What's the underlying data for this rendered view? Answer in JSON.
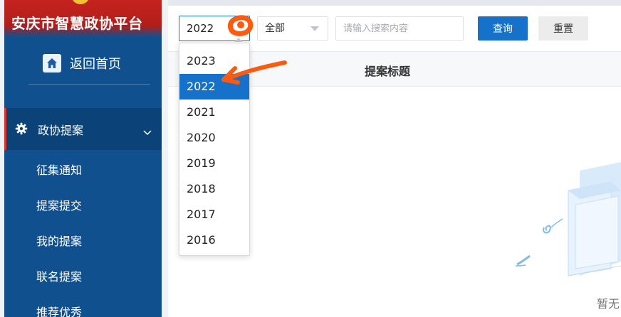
{
  "sidebar": {
    "app_title": "安庆市智慧政协平台",
    "home_label": "返回首页",
    "menu_group": {
      "label": "政协提案",
      "icon": "gear-icon",
      "expanded": true
    },
    "items": [
      {
        "label": "征集通知"
      },
      {
        "label": "提案提交"
      },
      {
        "label": "我的提案"
      },
      {
        "label": "联名提案"
      },
      {
        "label": "推荐优秀"
      }
    ]
  },
  "filters": {
    "year_value": "2022",
    "scope_value": "全部",
    "search_placeholder": "请输入搜索内容",
    "query_label": "查询",
    "reset_label": "重置"
  },
  "table": {
    "columns": [
      "提案标题"
    ]
  },
  "year_dropdown": {
    "options": [
      "2023",
      "2022",
      "2021",
      "2020",
      "2019",
      "2018",
      "2017",
      "2016"
    ],
    "selected": "2022"
  },
  "empty_state": {
    "text": "暂无"
  },
  "colors": {
    "sidebar_bg": "#10508f",
    "header_red": "#c5231f",
    "accent_blue": "#1571c9",
    "annotation_orange": "#ff5a0f"
  }
}
